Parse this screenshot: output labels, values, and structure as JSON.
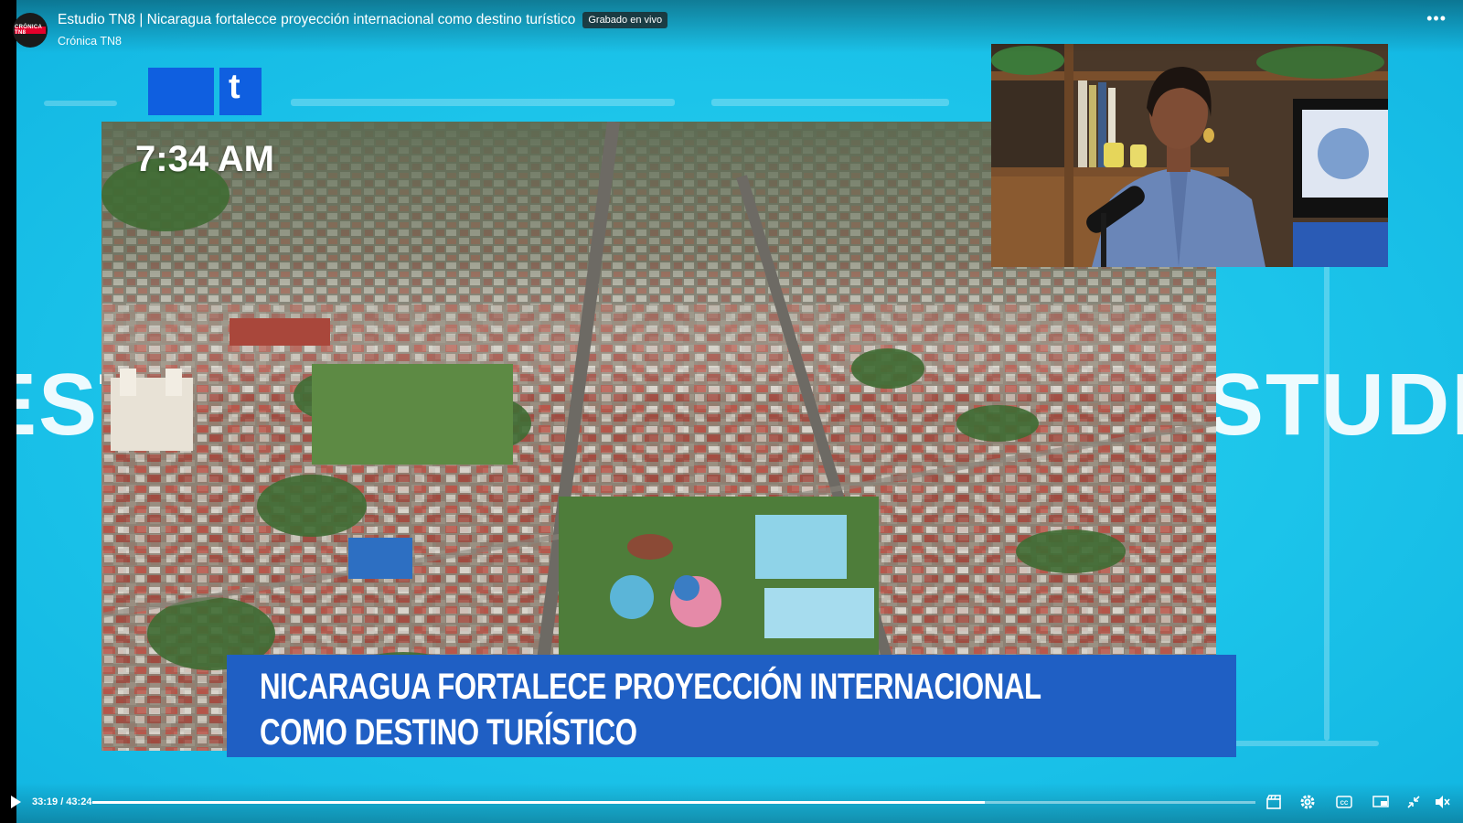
{
  "header": {
    "title": "Estudio TN8 | Nicaragua fortalecce proyección internacional como destino turístico",
    "live_badge": "Grabado en vivo",
    "channel": "Crónica TN8",
    "avatar_text": "CRÓNICA TN8",
    "more_icon": "more-options-icon"
  },
  "broadcast": {
    "clock": "7:34 AM",
    "background_word": "STUDIO",
    "background_word_left": "EST",
    "logo_glyph": "t",
    "headline_line1": "NICARAGUA FORTALECE PROYECCIÓN INTERNACIONAL",
    "headline_line2": "COMO DESTINO TURÍSTICO"
  },
  "player": {
    "current_time": "33:19",
    "duration": "43:24",
    "time_text": "33:19 / 43:24",
    "progress_fraction": 0.7676,
    "icons": [
      "play-icon",
      "clip-icon",
      "settings-gear-icon",
      "captions-icon",
      "miniplayer-icon",
      "exit-fullscreen-icon",
      "mute-icon"
    ]
  },
  "colors": {
    "studio_cyan": "#1cc4ea",
    "lower_third_blue": "#1f5fc4",
    "logo_blue": "#0f5fe0"
  }
}
